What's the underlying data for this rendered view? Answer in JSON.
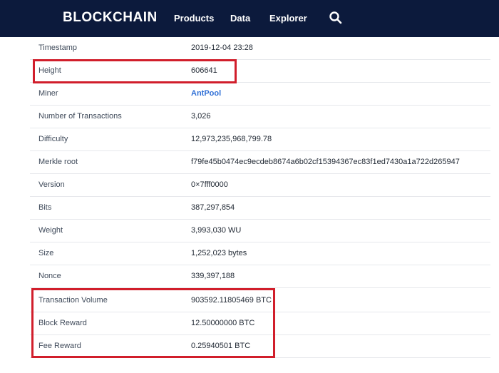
{
  "header": {
    "logo": "BLOCKCHAIN",
    "nav": [
      "Products",
      "Data",
      "Explorer"
    ],
    "search_icon": "search-icon",
    "background": "#0c1a3c"
  },
  "block_details": [
    {
      "label": "Timestamp",
      "value": "2019-12-04 23:28"
    },
    {
      "label": "Height",
      "value": "606641"
    },
    {
      "label": "Miner",
      "value": "AntPool"
    },
    {
      "label": "Number of Transactions",
      "value": "3,026"
    },
    {
      "label": "Difficulty",
      "value": "12,973,235,968,799.78"
    },
    {
      "label": "Merkle root",
      "value": "f79fe45b0474ec9ecdeb8674a6b02cf15394367ec83f1ed7430a1a722d265947"
    },
    {
      "label": "Version",
      "value": "0×7fff0000"
    },
    {
      "label": "Bits",
      "value": "387,297,854"
    },
    {
      "label": "Weight",
      "value": "3,993,030 WU"
    },
    {
      "label": "Size",
      "value": "1,252,023 bytes"
    },
    {
      "label": "Nonce",
      "value": "339,397,188"
    },
    {
      "label": "Transaction Volume",
      "value": "903592.11805469 BTC"
    },
    {
      "label": "Block Reward",
      "value": "12.50000000 BTC"
    },
    {
      "label": "Fee Reward",
      "value": "0.25940501 BTC"
    }
  ],
  "colors": {
    "highlight": "#d11e2b",
    "link": "#2f6fd6"
  }
}
